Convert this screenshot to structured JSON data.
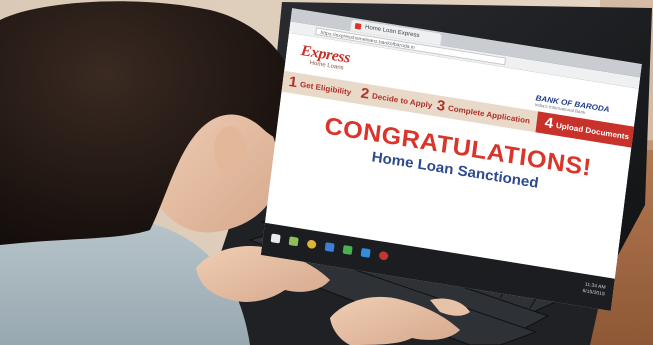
{
  "browser": {
    "tab_title": "Home Loan Express",
    "url": "https://expresshomeloans.bankofbaroda.in"
  },
  "page": {
    "logo_word": "Express",
    "logo_sub": "Home Loans",
    "brand_name": "BANK OF BARODA",
    "brand_sub": "India's International Bank",
    "steps": [
      {
        "number": "1",
        "label": "Get Eligibility"
      },
      {
        "number": "2",
        "label": "Decide to Apply"
      },
      {
        "number": "3",
        "label": "Complete Application"
      },
      {
        "number": "4",
        "label": "Upload Documents"
      }
    ],
    "headline": "CONGRATULATIONS!",
    "subheadline": "Home Loan Sanctioned"
  },
  "taskbar": {
    "clock_time": "11:34 AM",
    "clock_date": "6/15/2015",
    "icons": [
      "windows-icon",
      "search-icon",
      "chrome-icon",
      "file-explorer-icon",
      "store-icon",
      "photos-icon",
      "mail-icon",
      "media-icon"
    ]
  },
  "colors": {
    "accent_red": "#c8322b",
    "headline_red": "#d9352b",
    "subheadline_blue": "#2c4a8f",
    "step_band": "#e8d9c8",
    "taskbar": "#1b1d20"
  }
}
